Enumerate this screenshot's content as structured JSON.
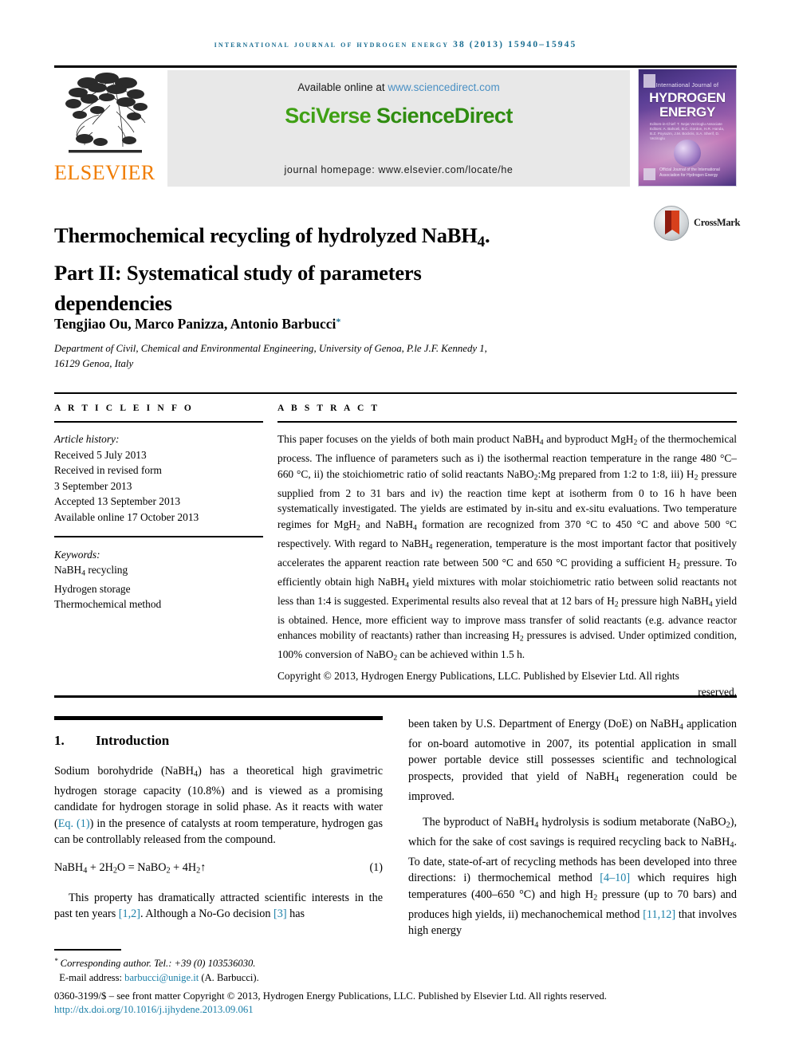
{
  "running_head": "International Journal of Hydrogen Energy 38 (2013) 15940–15945",
  "banner": {
    "publisher_name": "ELSEVIER",
    "available_prefix": "Available online at ",
    "available_url": "www.sciencedirect.com",
    "logo_part1": "SciVerse ",
    "logo_part2": "ScienceDirect",
    "homepage": "journal homepage: www.elsevier.com/locate/he",
    "cover": {
      "line_small": "International Journal of",
      "line_big_1": "HYDROGEN",
      "line_big_2": "ENERGY",
      "editors": "Editors-in-Chief: T. Nejat Veziroglu\nAssociate Editors: A. Bahceli, B.C. Gordon, H.R. Handa,\nB.Z. Poyrazm, J.M. Bockris,\nS.A. Sherif, D. Veziroglu",
      "footer": "Official Journal of the International\nAssociation for Hydrogen Energy"
    }
  },
  "crossmark": {
    "label": "CrossMark"
  },
  "article": {
    "title_line1": "Thermochemical recycling of hydrolyzed NaBH",
    "title_sub1": "4",
    "title_line1_end": ".",
    "title_line2": "Part II: Systematical study of parameters",
    "title_line3": "dependencies",
    "authors": "Tengjiao Ou, Marco Panizza, Antonio Barbucci",
    "author_mark": "*",
    "affiliation_line1": "Department of Civil, Chemical and Environmental Engineering, University of Genoa, P.le J.F. Kennedy 1,",
    "affiliation_line2": "16129 Genoa, Italy"
  },
  "article_info": {
    "heading": "A R T I C L E   I N F O",
    "history_label": "Article history:",
    "history": [
      "Received 5 July 2013",
      "Received in revised form",
      "3 September 2013",
      "Accepted 13 September 2013",
      "Available online 17 October 2013"
    ],
    "keywords_label": "Keywords:",
    "keywords": [
      "NaBH4 recycling",
      "Hydrogen storage",
      "Thermochemical method"
    ]
  },
  "abstract": {
    "heading": "A B S T R A C T",
    "body": "This paper focuses on the yields of both main product NaBH4 and byproduct MgH2 of the thermochemical process. The influence of parameters such as i) the isothermal reaction temperature in the range 480 °C–660 °C, ii) the stoichiometric ratio of solid reactants NaBO2:Mg prepared from 1:2 to 1:8, iii) H2 pressure supplied from 2 to 31 bars and iv) the reaction time kept at isotherm from 0 to 16 h have been systematically investigated. The yields are estimated by in-situ and ex-situ evaluations. Two temperature regimes for MgH2 and NaBH4 formation are recognized from 370 °C to 450 °C and above 500 °C respectively. With regard to NaBH4 regeneration, temperature is the most important factor that positively accelerates the apparent reaction rate between 500 °C and 650 °C providing a sufficient H2 pressure. To efficiently obtain high NaBH4 yield mixtures with molar stoichiometric ratio between solid reactants not less than 1:4 is suggested. Experimental results also reveal that at 12 bars of H2 pressure high NaBH4 yield is obtained. Hence, more efficient way to improve mass transfer of solid reactants (e.g. advance reactor enhances mobility of reactants) rather than increasing H2 pressures is advised. Under optimized condition, 100% conversion of NaBO2 can be achieved within 1.5 h.",
    "copyright_main": "Copyright © 2013, Hydrogen Energy Publications, LLC. Published by Elsevier Ltd. All rights",
    "copyright_last": "reserved."
  },
  "introduction": {
    "number": "1.",
    "title": "Introduction",
    "p1_a": "Sodium borohydride (NaBH",
    "p1_sub": "4",
    "p1_b": ") has a theoretical high gravimetric hydrogen storage capacity (10.8%) and is viewed as a promising candidate for hydrogen storage in solid phase. As it reacts with water (",
    "p1_link": "Eq. (1)",
    "p1_c": ") in the presence of catalysts at room temperature, hydrogen gas can be controllably released from the compound.",
    "equation": "NaBH4 + 2H2O = NaBO2 + 4H2↑",
    "equation_number": "(1)",
    "p2_a": "This property has dramatically attracted scientific interests in the past ten years ",
    "p2_ref1": "[1,2]",
    "p2_b": ". Although a No-Go decision ",
    "p2_ref2": "[3]",
    "p2_c": " has",
    "p3_a": "been taken by U.S. Department of Energy (DoE) on NaBH",
    "p3_sub": "4",
    "p3_b": " application for on-board automotive in 2007, its potential application in small power portable device still possesses scientific and technological prospects, provided that yield of NaBH4 regeneration could be improved.",
    "p4_a": "The byproduct of NaBH4 hydrolysis is sodium metaborate (NaBO2), which for the sake of cost savings is required recycling back to NaBH4. To date, state-of-art of recycling methods has been developed into three directions: i) thermochemical method ",
    "p4_ref1": "[4–10]",
    "p4_b": " which requires high temperatures (400–650 °C) and high H2 pressure (up to 70 bars) and produces high yields, ii) mechanochemical method ",
    "p4_ref2": "[11,12]",
    "p4_c": " that involves high energy"
  },
  "footer": {
    "corresponding_mark": "*",
    "corresponding": " Corresponding author. Tel.: +39 (0) 103536030.",
    "email_label": "E-mail address: ",
    "email": "barbucci@unige.it",
    "email_suffix": " (A. Barbucci).",
    "issn_copyright": "0360-3199/$ – see front matter Copyright © 2013, Hydrogen Energy Publications, LLC. Published by Elsevier Ltd. All rights reserved.",
    "doi": "http://dx.doi.org/10.1016/j.ijhydene.2013.09.061"
  },
  "colors": {
    "link": "#1a7fa8",
    "runhead": "#1a6e92",
    "elsevier_orange": "#f07c00",
    "sciencedirect_green": "#3fa014"
  }
}
